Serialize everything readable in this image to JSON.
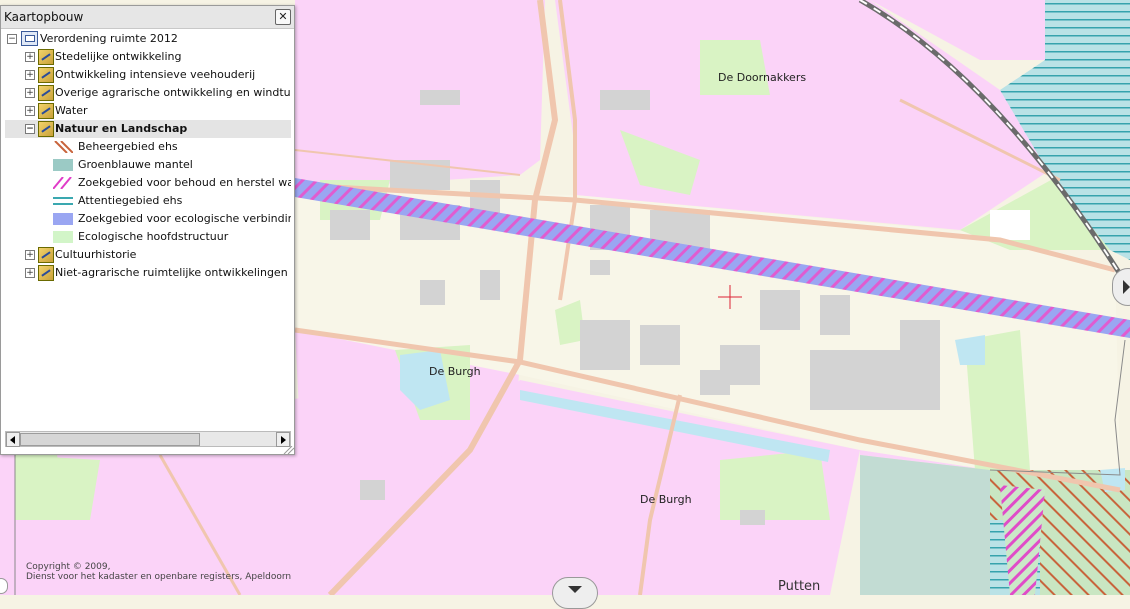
{
  "panel": {
    "title": "Kaartopbouw",
    "close_label": "✕",
    "root_label": "Verordening ruimte 2012",
    "layers": [
      {
        "label": "Stedelijke ontwikkeling",
        "expander": "+"
      },
      {
        "label": "Ontwikkeling intensieve veehouderij",
        "expander": "+"
      },
      {
        "label": "Overige agrarische ontwikkeling en windturbines",
        "expander": "+"
      },
      {
        "label": "Water",
        "expander": "+"
      },
      {
        "label": "Natuur en Landschap",
        "expander": "−",
        "selected": true
      },
      {
        "label": "Cultuurhistorie",
        "expander": "+"
      },
      {
        "label": "Niet-agrarische ruimtelijke ontwikkelingen buiten b",
        "expander": "+"
      }
    ],
    "legend": [
      {
        "label": "Beheergebied ehs",
        "symbol": "diag-brown",
        "color": "#c8643c"
      },
      {
        "label": "Groenblauwe mantel",
        "symbol": "fill-teal",
        "color": "#9bcac5"
      },
      {
        "label": "Zoekgebied voor behoud en herstel watersy",
        "symbol": "diag-magenta",
        "color": "#e03cc8"
      },
      {
        "label": "Attentiegebied ehs",
        "symbol": "hlines-teal",
        "color": "#3aa8b0"
      },
      {
        "label": "Zoekgebied voor ecologische verbindingszo",
        "symbol": "fill-blue",
        "color": "#9aa6f2"
      },
      {
        "label": "Ecologische hoofdstructuur",
        "symbol": "fill-lightgreen",
        "color": "#d2f5c8"
      }
    ]
  },
  "map": {
    "labels": {
      "doornakkers": "De Doornakkers",
      "burgh1": "De Burgh",
      "burgh2": "De Burgh",
      "putten": "Putten"
    },
    "copyright_line1": "Copyright © 2009,",
    "copyright_line2": "Dienst voor het kadaster en openbare registers, Apeldoorn",
    "colors": {
      "residential": "#fbd3f8",
      "base": "#f6f3e4",
      "green": "#d9f3c4",
      "water": "#bfe6f2",
      "road": "#f1c9b2",
      "building": "#d3d3d3",
      "corridor": "#9aa6f2"
    }
  }
}
